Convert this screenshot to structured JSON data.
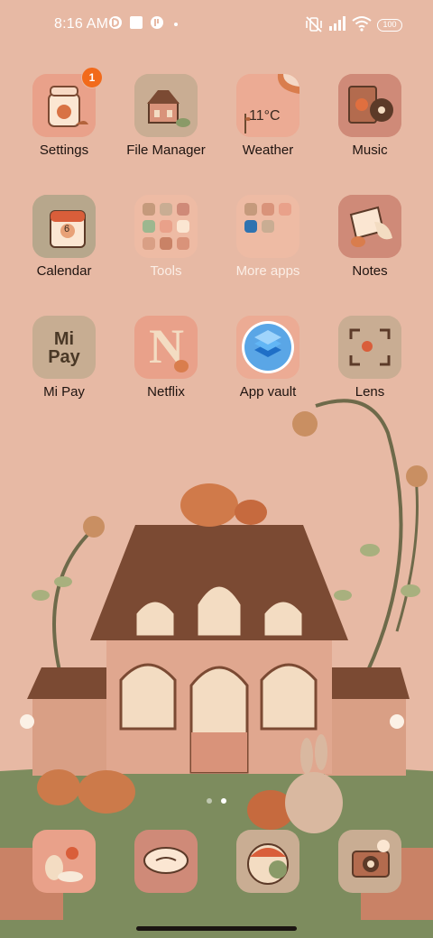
{
  "status_bar": {
    "time": "8:16 AM",
    "battery": "100",
    "icons": [
      "app-notification-icon",
      "square-notification-icon",
      "app-notification-icon",
      "small-dot-icon",
      "vibrate-off-icon",
      "signal-icon",
      "wifi-icon",
      "battery-icon"
    ]
  },
  "apps": [
    {
      "label": "Settings",
      "badge": "1"
    },
    {
      "label": "File Manager"
    },
    {
      "label": "Weather",
      "temperature": "11°C"
    },
    {
      "label": "Music"
    },
    {
      "label": "Calendar",
      "date": "6"
    },
    {
      "label": "Tools"
    },
    {
      "label": "More apps"
    },
    {
      "label": "Notes"
    },
    {
      "label": "Mi Pay",
      "icon_text": "Mi Pay"
    },
    {
      "label": "Netflix",
      "icon_text": "N"
    },
    {
      "label": "App vault"
    },
    {
      "label": "Lens"
    }
  ],
  "dock": [
    "bunny-flower-icon",
    "leaf-card-icon",
    "bird-icon",
    "camera-icon"
  ],
  "page_indicator": {
    "count": 2,
    "active": 2
  },
  "colors": {
    "wallpaper": "#e7b9a4",
    "ground": "#7d8c5e",
    "badge": "#f26a1b",
    "roof": "#7b4a33"
  }
}
